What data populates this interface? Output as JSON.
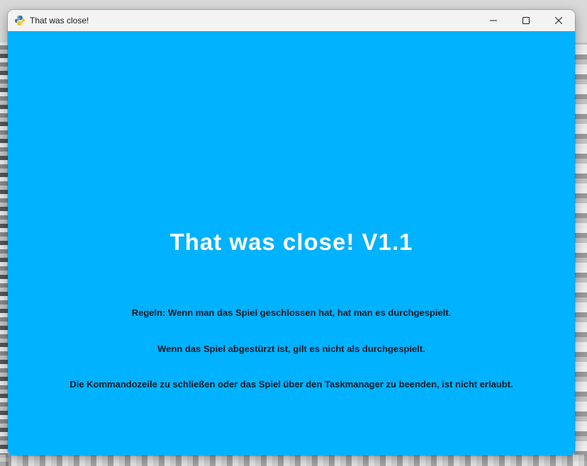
{
  "window": {
    "title": "That was close!",
    "app_icon": "python-icon",
    "controls": [
      "minimize-icon",
      "maximize-icon",
      "close-icon"
    ]
  },
  "game": {
    "title": "That was close! V1.1",
    "rules": [
      "Regeln: Wenn man das Spiel geschlossen hat, hat man es durchgespielt.",
      "Wenn das Spiel abgestürzt ist, gilt es nicht als durchgespielt.",
      "Die Kommandozeile zu schließen oder das Spiel über den Taskmanager zu beenden, ist nicht erlaubt."
    ]
  },
  "colors": {
    "background": "#00b2ff",
    "title_text": "#ffffff",
    "rules_text": "#0a1a24",
    "titlebar": "#f3f3f3"
  }
}
